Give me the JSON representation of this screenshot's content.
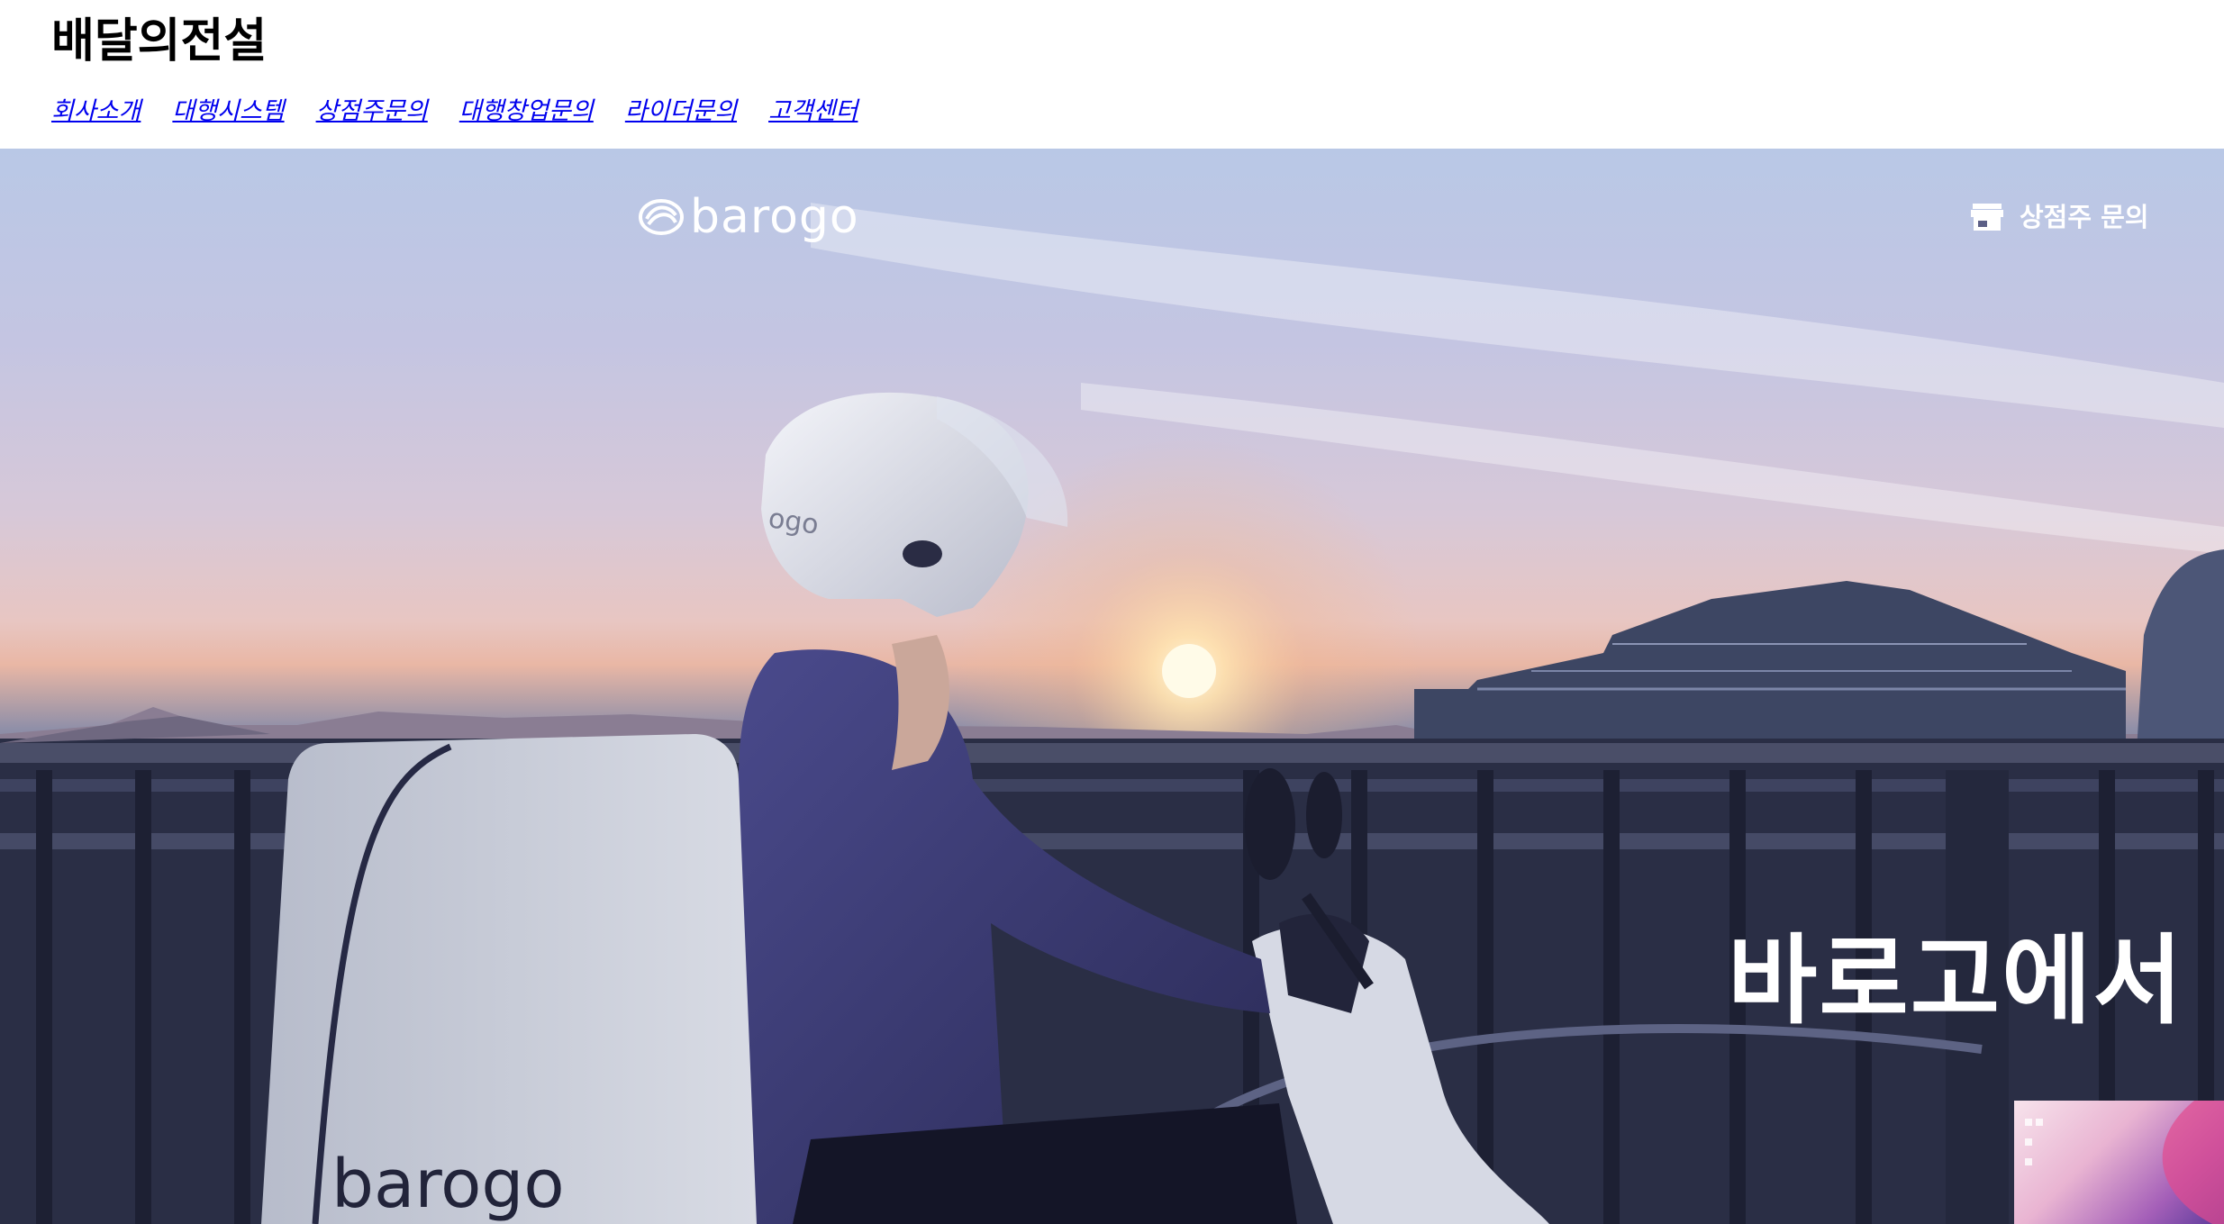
{
  "header": {
    "site_title": "배달의전설",
    "nav": [
      {
        "label": "회사소개"
      },
      {
        "label": "대행시스템"
      },
      {
        "label": "상점주문의"
      },
      {
        "label": "대행창업문의"
      },
      {
        "label": "라이더문의"
      },
      {
        "label": "고객센터"
      }
    ]
  },
  "hero": {
    "logo_text": "barogo",
    "logo_icon": "barogo-swirl-logo",
    "store_inquiry_label": "상점주 문의",
    "store_icon": "store-icon",
    "headline": "바로고에서 ",
    "box_brand_text": "barogo",
    "helmet_brand_text": "ogo",
    "colors": {
      "link": "#0000ee",
      "headline": "#ffffff",
      "sky_top": "#b9c8e6",
      "sunset": "#e9b7a5"
    }
  }
}
